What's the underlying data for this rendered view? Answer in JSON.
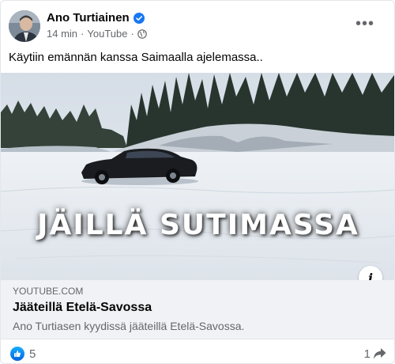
{
  "post": {
    "author": "Ano Turtiainen",
    "time": "14 min",
    "separator": "·",
    "source": "YouTube",
    "separator2": "·",
    "text": "Käytiin emännän kanssa Saimaalla ajelemassa..",
    "more_icon": "more-horizontal-icon",
    "verified_icon": "verified-badge-icon",
    "privacy_icon": "globe-icon"
  },
  "media": {
    "overlay_title": "JÄILLÄ SUTIMASSA",
    "info_label": "i"
  },
  "link_card": {
    "domain": "YOUTUBE.COM",
    "title": "Jääteillä Etelä-Savossa",
    "description": "Ano Turtiasen kyydissä jääteillä Etelä-Savossa."
  },
  "footer": {
    "like_count": "5",
    "share_count": "1",
    "like_icon": "thumbs-up-icon",
    "share_icon": "share-arrow-icon"
  },
  "colors": {
    "facebook_blue": "#1877f2",
    "secondary_text": "#65676b",
    "card_background": "#f0f2f5"
  }
}
